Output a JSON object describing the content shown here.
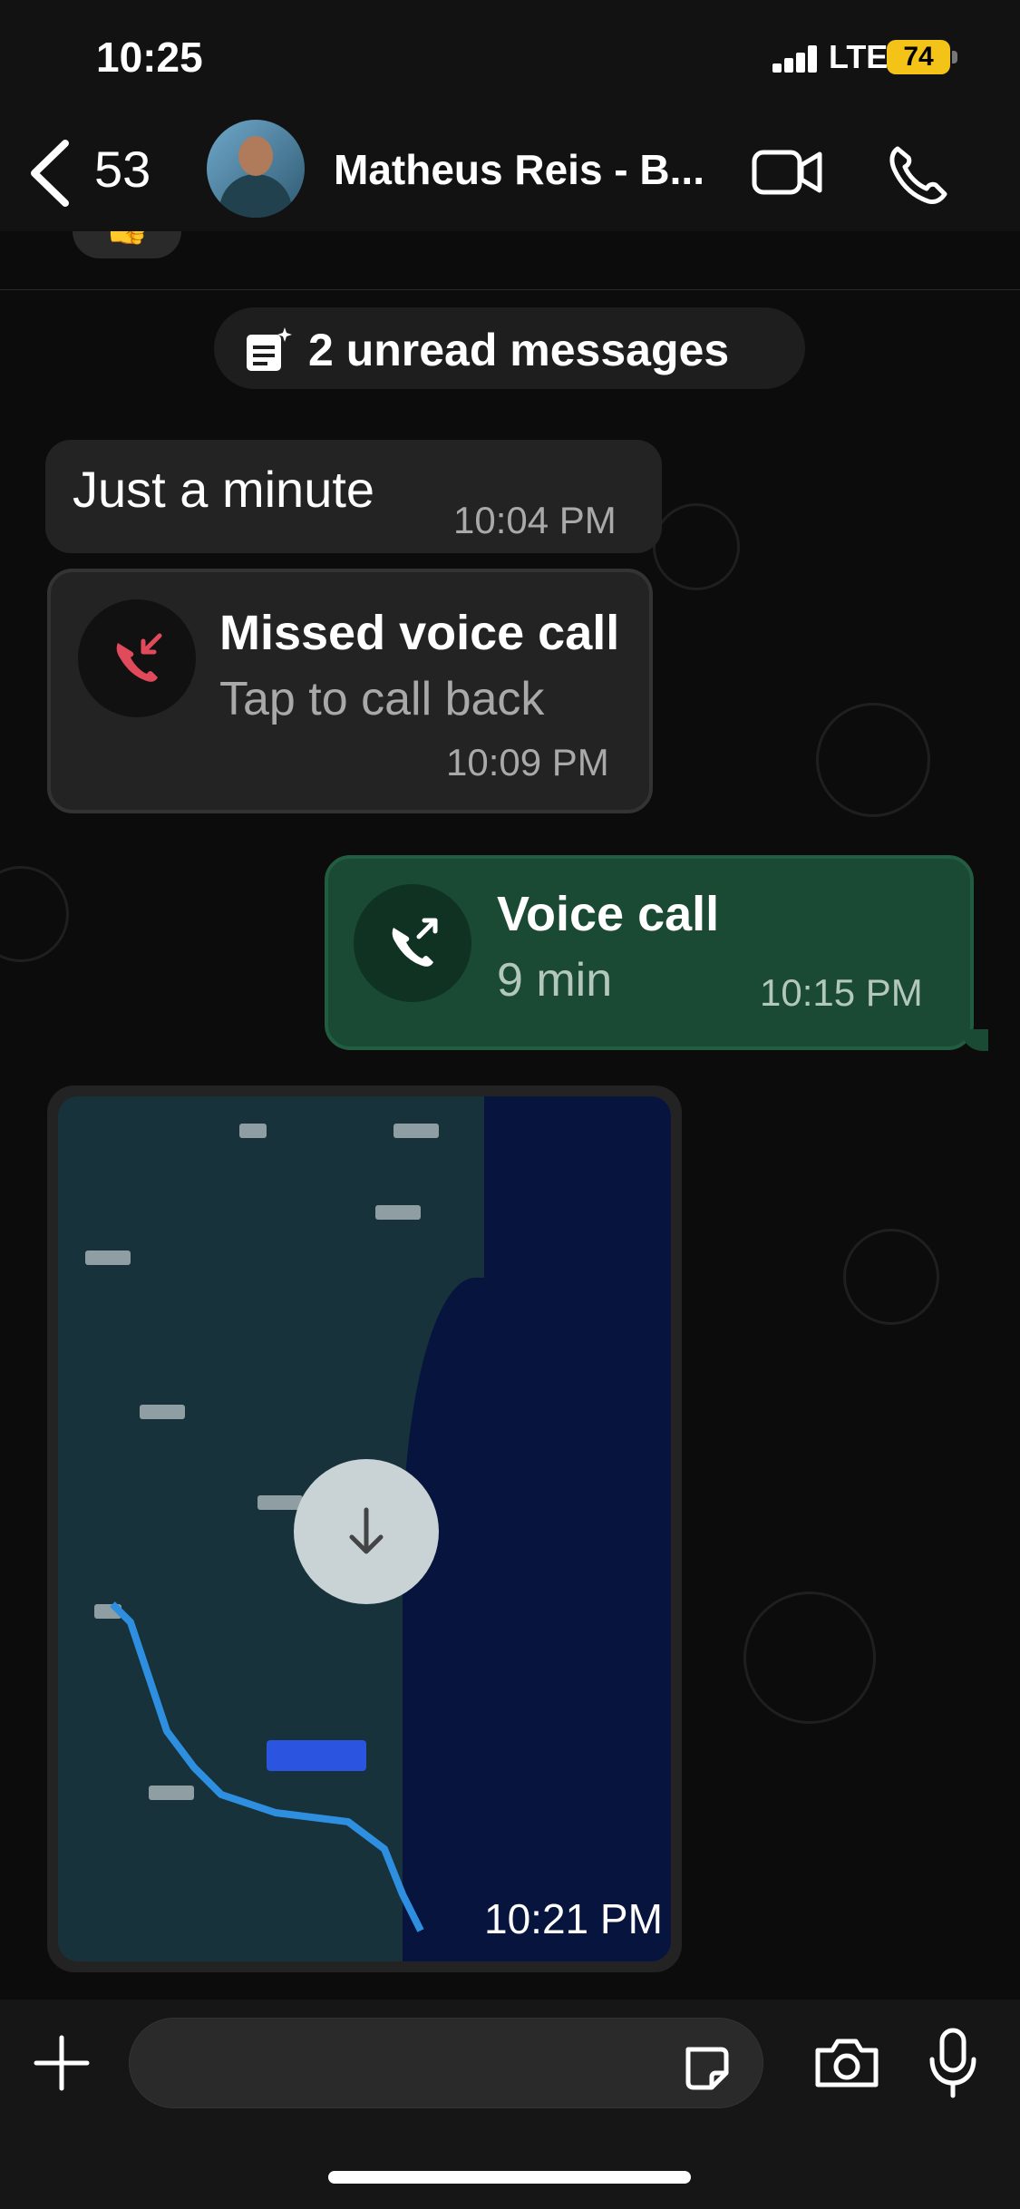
{
  "status": {
    "time": "10:25",
    "network": "LTE",
    "battery": "74"
  },
  "header": {
    "back_count": "53",
    "contact_name": "Matheus Reis - B..."
  },
  "chat": {
    "unread_label": "2 unread messages",
    "messages": [
      {
        "text": "Just a minute",
        "time": "10:04 PM"
      },
      {
        "title": "Missed voice call",
        "subtitle": "Tap to call back",
        "time": "10:09 PM"
      },
      {
        "title": "Voice call",
        "subtitle": "9 min",
        "time": "10:15 PM"
      },
      {
        "time": "10:21 PM"
      }
    ]
  },
  "colors": {
    "incoming": "#232323",
    "outgoing": "#1a4a33",
    "missed": "#e04a5a",
    "battery": "#f3c318"
  },
  "icons": [
    "back-chevron-icon",
    "video-call-icon",
    "phone-icon",
    "unread-icon",
    "missed-call-icon",
    "outgoing-call-icon",
    "download-icon",
    "plus-icon",
    "sticker-icon",
    "camera-icon",
    "microphone-icon"
  ]
}
